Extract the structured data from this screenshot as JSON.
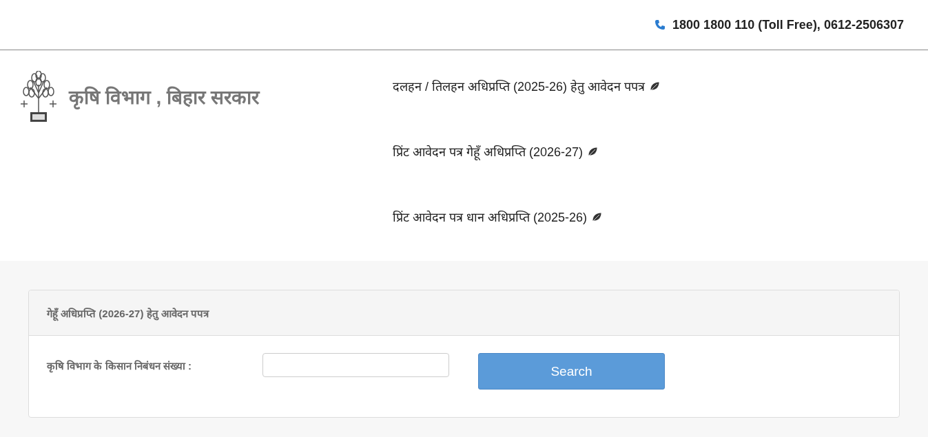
{
  "top_bar": {
    "phone": "1800 1800 110 (Toll Free), 0612-2506307"
  },
  "header": {
    "title": "कृषि विभाग , बिहार सरकार",
    "links": [
      {
        "label": "दलहन / तिलहन अधिप्रप्ति (2025-26) हेतु आवेदन पपत्र"
      },
      {
        "label": "प्रिंट आवेदन पत्र गेहूँ अधिप्रप्ति (2026-27)"
      },
      {
        "label": "प्रिंट आवेदन पत्र धान अधिप्रप्ति (2025-26)"
      }
    ]
  },
  "panel": {
    "heading": "गेहूँ अधिप्रप्ति (2026-27) हेतु आवेदन पपत्र",
    "field_label": "कृषि विभाग के किसान निबंधन संख्या :",
    "button": "Search"
  }
}
